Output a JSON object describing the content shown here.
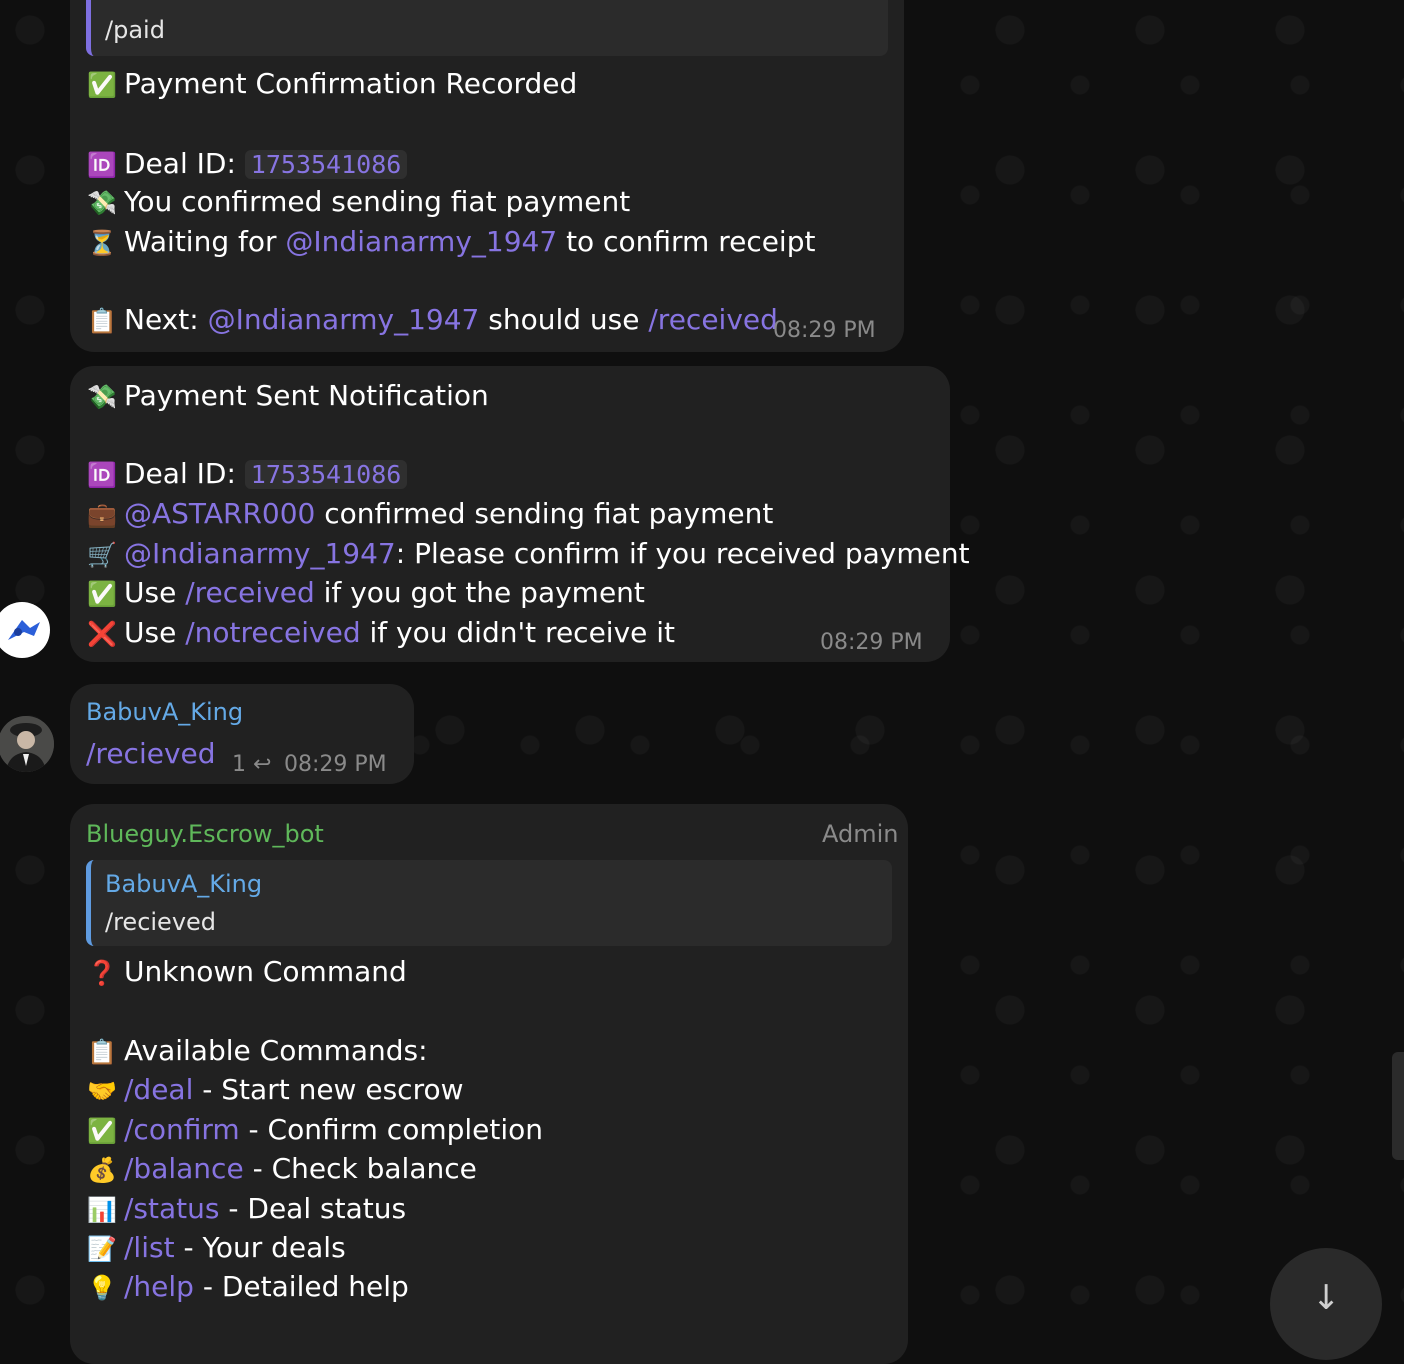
{
  "msg1": {
    "quote_text": "/paid",
    "title": "Payment Confirmation Recorded",
    "deal_label": "Deal ID:",
    "deal_id": "1753541086",
    "line_sent": "You confirmed sending fiat payment",
    "wait_prefix": "Waiting for",
    "wait_user": "@Indianarmy_1947",
    "wait_suffix": "to confirm receipt",
    "next_label": "Next:",
    "next_user": "@Indianarmy_1947",
    "next_mid": "should use",
    "next_cmd": "/received",
    "time": "08:29 PM"
  },
  "msg2": {
    "title": "Payment Sent Notification",
    "deal_label": "Deal ID:",
    "deal_id": "1753541086",
    "sender_user": "@ASTARR000",
    "sender_text": "confirmed sending fiat payment",
    "buyer_user": "@Indianarmy_1947",
    "buyer_text": ": Please confirm if you received payment",
    "use1_prefix": "Use",
    "use1_cmd": "/received",
    "use1_suffix": "if you got the payment",
    "use2_prefix": "Use",
    "use2_cmd": "/notreceived",
    "use2_suffix": "if you didn't receive it",
    "time": "08:29 PM"
  },
  "msg3": {
    "sender": "BabuvA_King",
    "text": "/recieved",
    "reply_count": "1",
    "time": "08:29 PM"
  },
  "msg4": {
    "sender": "Blueguy.Escrow_bot",
    "role": "Admin",
    "quote_name": "BabuvA_King",
    "quote_text": "/recieved",
    "title": "Unknown Command",
    "avail": "Available Commands:",
    "commands": [
      {
        "cmd": "/deal",
        "desc": " - Start new escrow"
      },
      {
        "cmd": "/confirm",
        "desc": " - Confirm completion"
      },
      {
        "cmd": "/balance",
        "desc": " - Check balance"
      },
      {
        "cmd": "/status",
        "desc": " - Deal status"
      },
      {
        "cmd": "/list",
        "desc": " - Your deals"
      },
      {
        "cmd": "/help",
        "desc": " - Detailed help"
      }
    ]
  },
  "icons": {
    "check": "✅",
    "id": "🆔",
    "money": "💸",
    "hourglass": "⏳",
    "clipboard": "📋",
    "briefcase": "💼",
    "cart": "🛒",
    "cross": "❌",
    "question": "❓",
    "handshake": "🤝",
    "moneybag": "💰",
    "chart": "📊",
    "memo": "📝",
    "bulb": "💡",
    "reply": "↩",
    "down": "↓"
  },
  "colors": {
    "accent": "#8774e1",
    "bubble": "#212121",
    "bot_name": "#5fb85a",
    "user_name": "#64a9e6"
  }
}
